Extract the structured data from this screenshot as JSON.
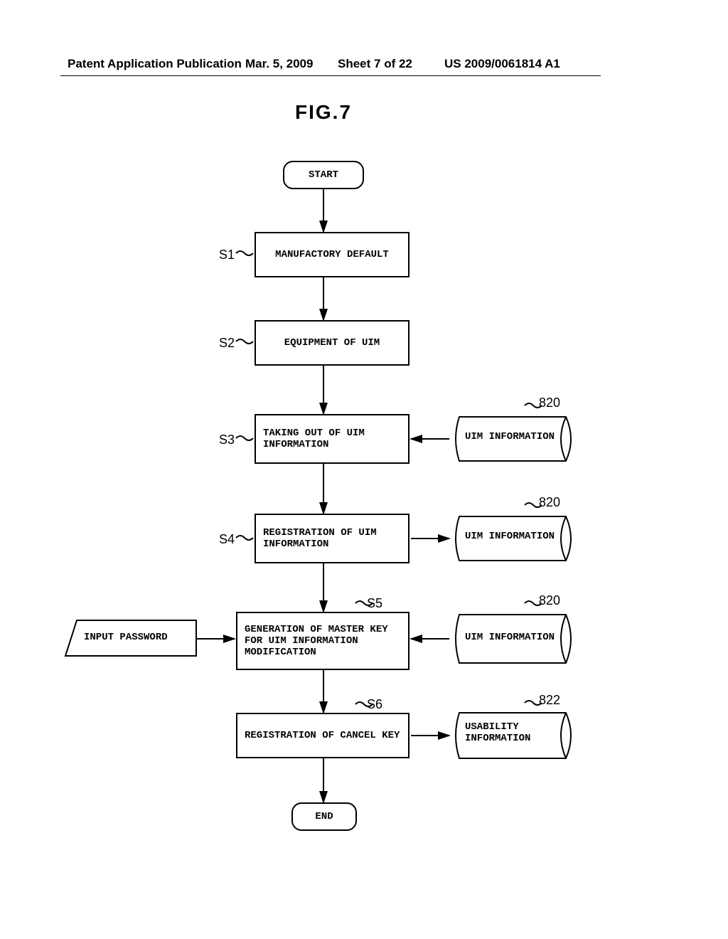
{
  "header": {
    "pub_label": "Patent Application Publication",
    "date": "Mar. 5, 2009",
    "sheet": "Sheet 7 of 22",
    "pubno": "US 2009/0061814 A1"
  },
  "figure_title": "FIG.7",
  "steps": {
    "start": "START",
    "s1": {
      "label": "S1",
      "text": "MANUFACTORY DEFAULT"
    },
    "s2": {
      "label": "S2",
      "text": "EQUIPMENT OF UIM"
    },
    "s3": {
      "label": "S3",
      "text": "TAKING OUT OF UIM INFORMATION"
    },
    "s4": {
      "label": "S4",
      "text": "REGISTRATION OF UIM INFORMATION"
    },
    "s5": {
      "label": "S5",
      "text": "GENERATION OF MASTER KEY FOR UIM INFORMATION MODIFICATION"
    },
    "s6": {
      "label": "S6",
      "text": "REGISTRATION OF CANCEL KEY"
    },
    "end": "END"
  },
  "docs": {
    "d1": {
      "ref": "820",
      "text": "UIM INFORMATION"
    },
    "d2": {
      "ref": "820",
      "text": "UIM INFORMATION"
    },
    "d3": {
      "ref": "820",
      "text": "UIM INFORMATION"
    },
    "d4": {
      "ref": "822",
      "text": "USABILITY INFORMATION"
    }
  },
  "input": {
    "text": "INPUT PASSWORD"
  }
}
